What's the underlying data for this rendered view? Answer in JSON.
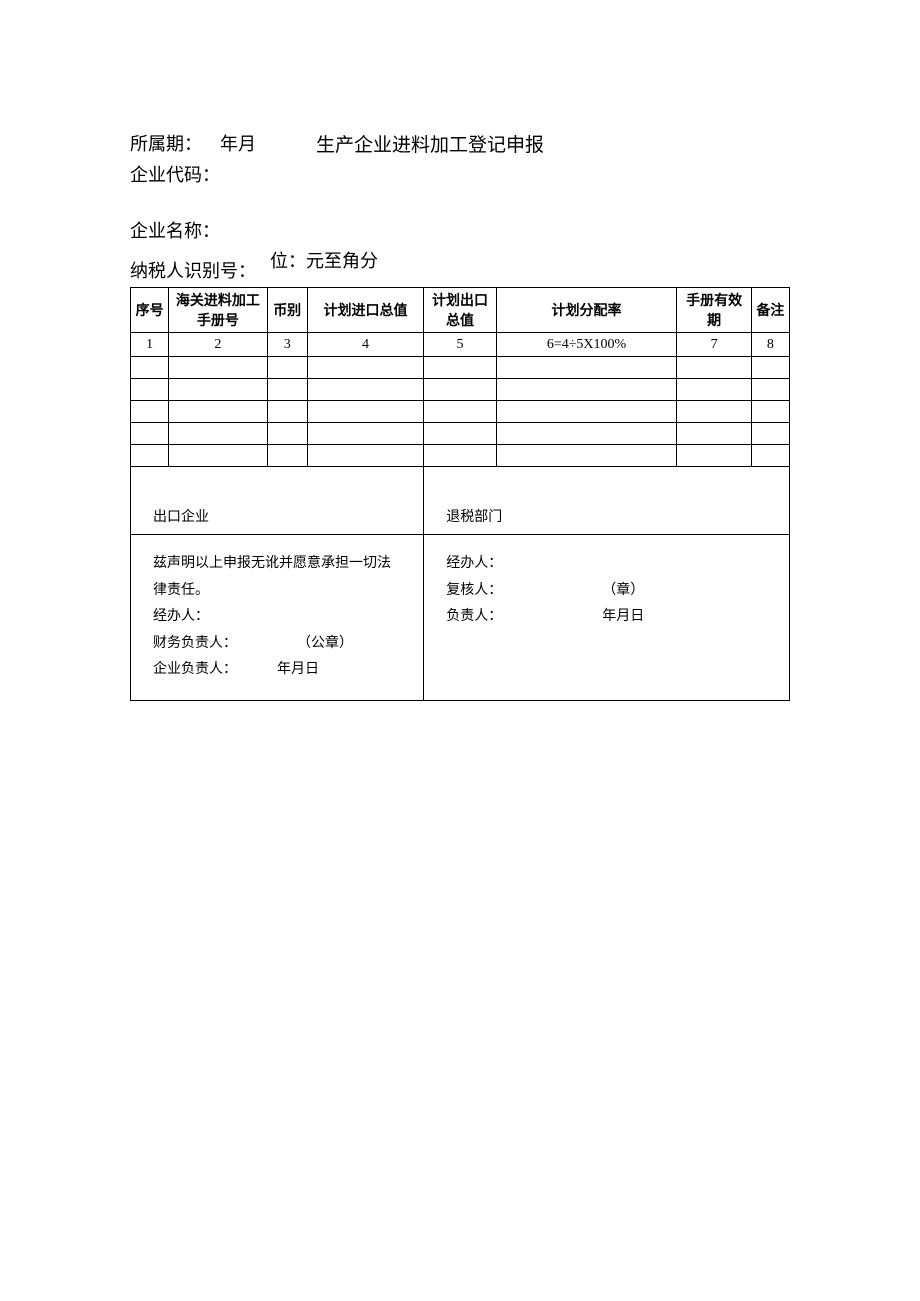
{
  "header": {
    "period_label": "所属期：",
    "period_value": "年月",
    "title": "生产企业进料加工登记申报",
    "company_code_label": "企业代码：",
    "company_name_label": "企业名称：",
    "taxid_label": "纳税人识别号：",
    "unit_label": "位：元至角分"
  },
  "table_headers": {
    "col1": "序号",
    "col2": "海关进料加工手册号",
    "col3": "币别",
    "col4": "计划进口总值",
    "col5": "计划出口总值",
    "col6": "计划分配率",
    "col7": "手册有效期",
    "col8": "备注"
  },
  "num_row": {
    "c1": "1",
    "c2": "2",
    "c3": "3",
    "c4": "4",
    "c5": "5",
    "c6": "6=4÷5X100%",
    "c7": "7",
    "c8": "8"
  },
  "footer": {
    "left_title": "出口企业",
    "right_title": "退税部门",
    "left": {
      "declaration": "兹声明以上申报无讹并愿意承担一切法律责任。",
      "handler": "经办人：",
      "finance": "财务负责人：",
      "stamp": "（公章）",
      "company_head": "企业负责人：",
      "date": "年月日"
    },
    "right": {
      "handler": "经办人：",
      "reviewer": "复核人：",
      "stamp": "（章）",
      "head": "负责人：",
      "date": "年月日"
    }
  }
}
